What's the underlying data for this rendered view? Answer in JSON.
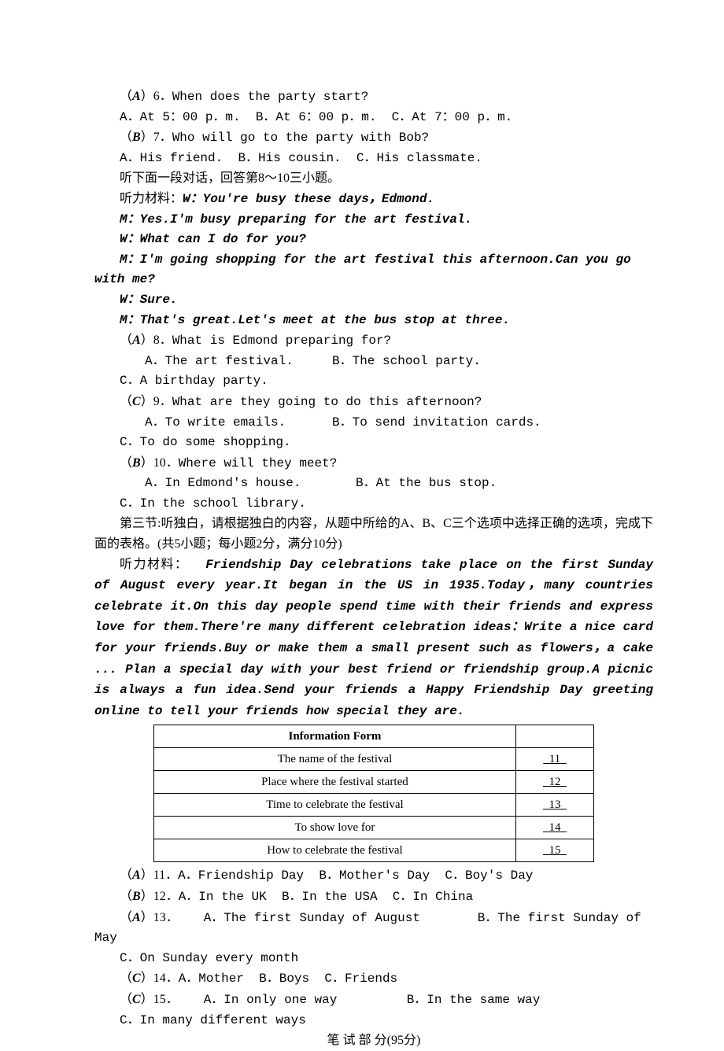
{
  "q6": {
    "prefix": "（",
    "ans": "A",
    "suffix": "）6．",
    "text": "When does the party start?",
    "a": "A．At 5：00 p．m.",
    "b": "B．At 6：00 p．m.",
    "c": "C．At 7：00 p．m."
  },
  "q7": {
    "prefix": "（",
    "ans": "B",
    "suffix": "）7．",
    "text": "Who will go to the party with Bob?",
    "a": "A．His friend.",
    "b": "B．His cousin.",
    "c": "C．His classmate."
  },
  "lead2": "听下面一段对话，回答第8～10三小题。",
  "script2": {
    "lead": "听力材料：",
    "l1": "W：You're busy these days，Edmond.",
    "l2": "M：Yes.I'm busy preparing for the art festival.",
    "l3": "W：What can I do for you?",
    "l4": "M：I'm going shopping for the art festival this afternoon.Can you go with me?",
    "l5": "W：Sure.",
    "l6": "M：That's great.Let's meet at the bus stop at three."
  },
  "q8": {
    "prefix": "（",
    "ans": "A",
    "suffix": "）8．",
    "text": "What is Edmond preparing for?",
    "a": "A．The art festival.",
    "b": "B．The school party.",
    "c": "C．A birthday party."
  },
  "q9": {
    "prefix": "（",
    "ans": "C",
    "suffix": "）9．",
    "text": "What are they going to do this afternoon?",
    "a": "A．To write e­mails.",
    "b": "B．To send invitation cards.",
    "c": "C．To do some shopping."
  },
  "q10": {
    "prefix": "（",
    "ans": "B",
    "suffix": "）10．",
    "text": "Where will they meet?",
    "a": "A．In Edmond's house.",
    "b": "B．At the bus stop.",
    "c": "C．In the school library."
  },
  "section3": "第三节:听独白，请根据独白的内容，从题中所给的A、B、C三个选项中选择正确的选项，完成下面的表格。(共5小题；每小题2分，满分10分)",
  "passage_lead": "听力材料：",
  "passage": "Friendship Day celebrations take place on the first Sunday of August every year.It began in the US in 1935.Today，many countries celebrate it.On this day people spend time with their friends and express love for them.There're many different celebration ideas：Write a nice card for your friends.Buy or make them a small present such as flowers，a cake ... Plan a special day with your best friend or friendship group.A picnic is always a fun idea.Send your friends a Happy Friendship Day greeting online to tell your friends how special they are.",
  "table": {
    "header": "Information Form",
    "rows": [
      {
        "label": "The name of the festival",
        "blank": "11"
      },
      {
        "label": "Place where the festival started",
        "blank": "12"
      },
      {
        "label": "Time to celebrate the festival",
        "blank": "13"
      },
      {
        "label": "To show love for",
        "blank": "14"
      },
      {
        "label": "How to celebrate the festival",
        "blank": "15"
      }
    ]
  },
  "q11": {
    "prefix": "（",
    "ans": "A",
    "suffix": "）11．",
    "a": "A．Friendship Day",
    "b": "B．Mother's Day",
    "c": "C．Boy's Day"
  },
  "q12": {
    "prefix": "（",
    "ans": "B",
    "suffix": "）12．",
    "a": "A．In the UK",
    "b": "B．In the USA",
    "c": "C．In China"
  },
  "q13": {
    "prefix": "（",
    "ans": "A",
    "suffix": "）13．",
    "a": "A．The first Sunday of August",
    "b": "B．The first Sunday of May",
    "c": "C．On Sunday every month"
  },
  "q14": {
    "prefix": "（",
    "ans": "C",
    "suffix": "）14．",
    "a": "A．Mother",
    "b": "B．Boys",
    "c": "C．Friends"
  },
  "q15": {
    "prefix": "（",
    "ans": "C",
    "suffix": "）15．",
    "a": "A．In only one way",
    "b": "B．In the same way",
    "c": "C．In many different ways"
  },
  "written_header": "笔 试 部 分(95分)"
}
